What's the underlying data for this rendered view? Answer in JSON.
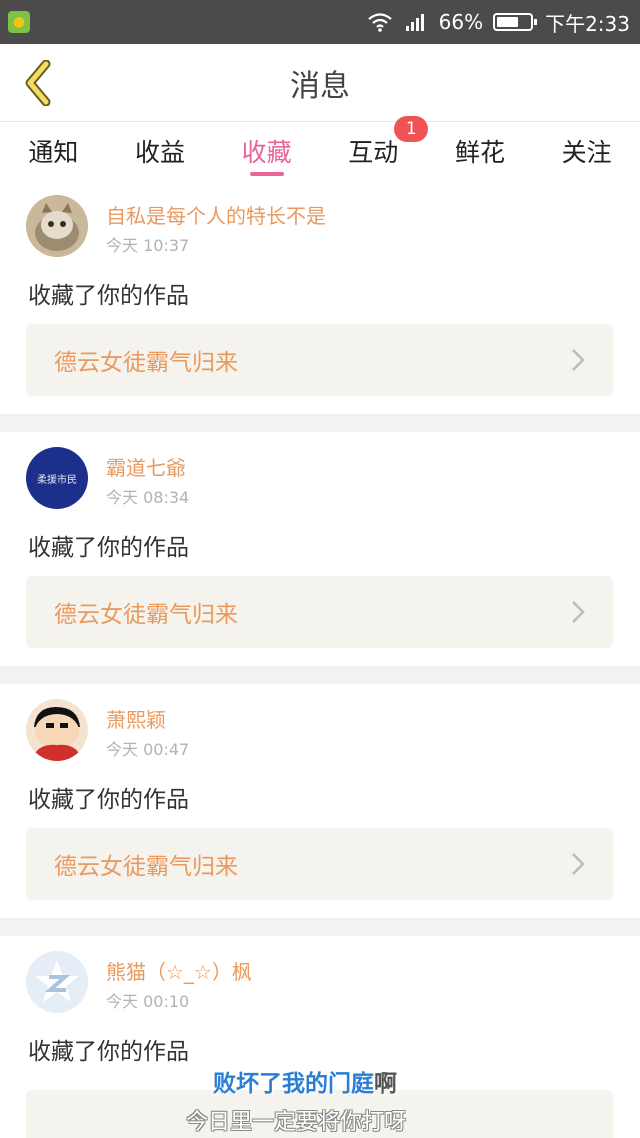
{
  "status_bar": {
    "battery_percent": "66%",
    "time": "下午2:33",
    "battery_level": 0.66
  },
  "header": {
    "title": "消息",
    "back_icon": "chevron-left-icon"
  },
  "tabs": [
    {
      "label": "通知",
      "active": false
    },
    {
      "label": "收益",
      "active": false
    },
    {
      "label": "收藏",
      "active": true
    },
    {
      "label": "互动",
      "active": false,
      "badge": "1"
    },
    {
      "label": "鲜花",
      "active": false
    },
    {
      "label": "关注",
      "active": false
    }
  ],
  "messages": [
    {
      "username": "自私是每个人的特长不是",
      "time": "今天 10:37",
      "action": "收藏了你的作品",
      "work_title": "德云女徒霸气归来"
    },
    {
      "username": "霸道七爺",
      "time": "今天 08:34",
      "action": "收藏了你的作品",
      "work_title": "德云女徒霸气归来",
      "avatar_text": "柔援市民"
    },
    {
      "username": "萧熙颖",
      "time": "今天 00:47",
      "action": "收藏了你的作品",
      "work_title": "德云女徒霸气归来"
    },
    {
      "username": "熊猫（☆_☆）枫",
      "time": "今天 00:10",
      "action": "收藏了你的作品",
      "work_title": ""
    }
  ],
  "overlay_captions": {
    "line1_highlight": "败坏了我的门庭",
    "line1_tail": "啊",
    "line2": "今日里一定要将你打呀"
  },
  "colors": {
    "accent": "#e8649b",
    "username": "#ea9a5f",
    "badge": "#f05353",
    "status_bar": "#4b4b4b"
  }
}
